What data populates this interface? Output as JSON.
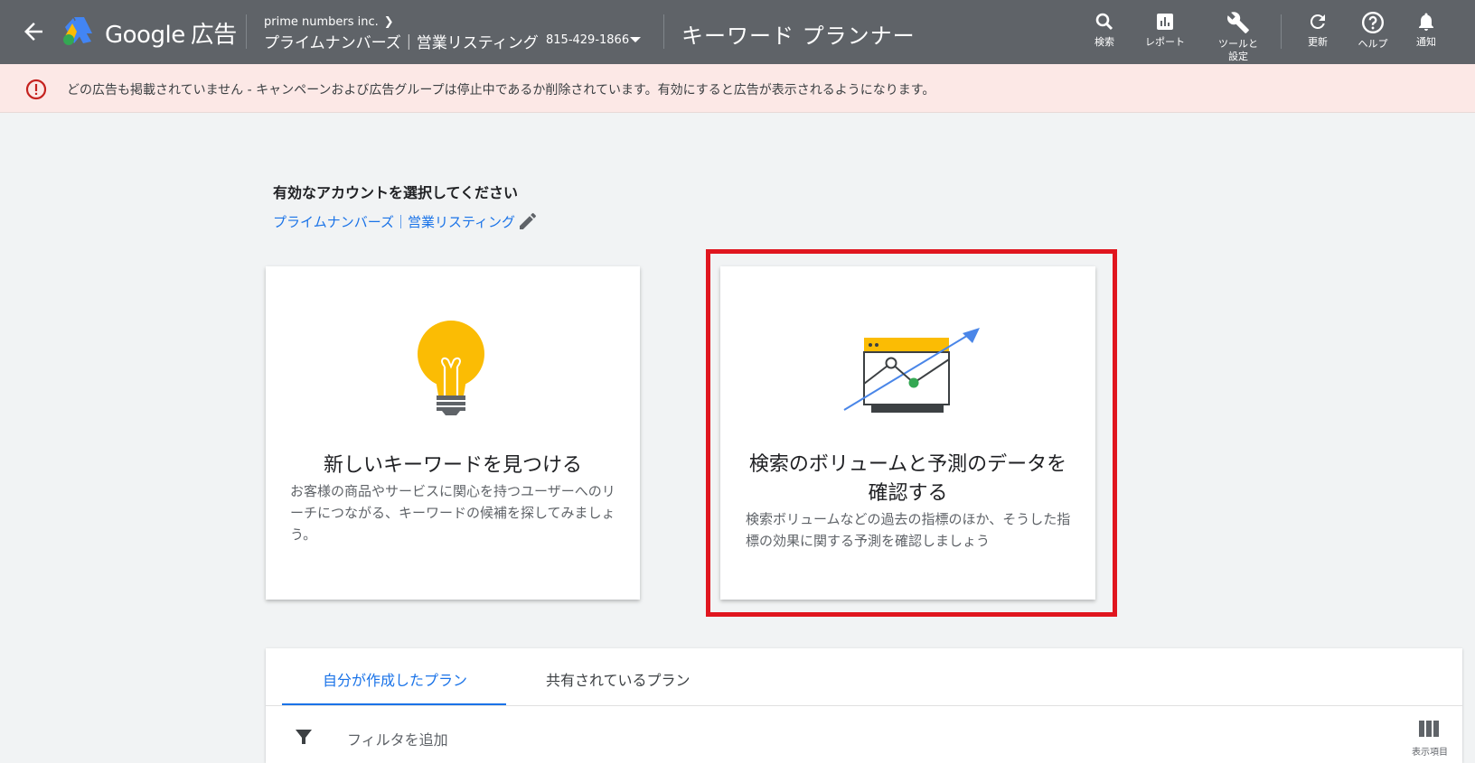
{
  "header": {
    "brand": "Google",
    "brand_suffix": "広告",
    "account_org": "prime numbers inc.",
    "account_name": "プライムナンバーズ｜営業リスティング",
    "account_id": "815-429-1866",
    "page_title": "キーワード プランナー",
    "tools": [
      {
        "label": "検索",
        "icon": "search-icon"
      },
      {
        "label": "レポート",
        "icon": "report-icon"
      },
      {
        "label": "ツールと\n設定",
        "icon": "wrench-icon"
      },
      {
        "label": "更新",
        "icon": "refresh-icon"
      },
      {
        "label": "ヘルプ",
        "icon": "help-icon"
      },
      {
        "label": "通知",
        "icon": "bell-icon"
      }
    ]
  },
  "alert": {
    "text": "どの広告も掲載されていません - キャンペーンおよび広告グループは停止中であるか削除されています。有効にすると広告が表示されるようになります。",
    "color": "#c5221f"
  },
  "account_select": {
    "title": "有効なアカウントを選択してください",
    "account_link": "プライムナンバーズ｜営業リスティング"
  },
  "cards": [
    {
      "title": "新しいキーワードを見つける",
      "desc": "お客様の商品やサービスに関心を持つユーザーへのリーチにつながる、キーワードの候補を探してみましょう。",
      "icon": "lightbulb-icon"
    },
    {
      "title": "検索のボリュームと予測のデータを確認する",
      "desc": "検索ボリュームなどの過去の指標のほか、そうした指標の効果に関する予測を確認しましょう",
      "icon": "forecast-chart-icon",
      "highlighted": true
    }
  ],
  "plans": {
    "tabs": [
      "自分が作成したプラン",
      "共有されているプラン"
    ],
    "active_tab": 0,
    "filter_label": "フィルタを追加",
    "columns_label": "表示項目"
  },
  "colors": {
    "header_bg": "#5f6368",
    "accent": "#1a73e8",
    "highlight_border": "#e0161f",
    "alert_bg": "#fce8e6"
  }
}
